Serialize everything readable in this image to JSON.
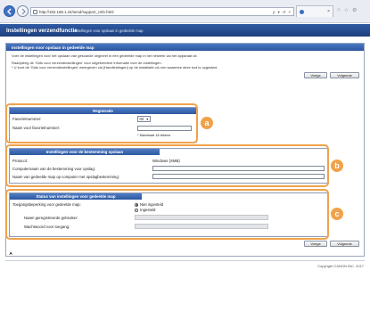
{
  "browser": {
    "url": "http://192.168.1.24/send/support_cnfe.html",
    "addr_tools": [
      "ρ",
      "▾",
      "↺",
      "×"
    ],
    "tab_close": "×",
    "win_tools": [
      "⌂",
      "☆",
      "⚙"
    ]
  },
  "app": {
    "title": "Instellingen verzendfunctie",
    "subtitle": "Instellingen voor opslaan in gedeelde map"
  },
  "section": {
    "title": "Instellingen voor opslaan in gedeelde map",
    "desc_1": "Voer de instellingen voor het opslaan van gescande origineel in een gedeelde map in het netwerk via het apparaat uit.",
    "desc_2": "Raadpleeg de 'Gids voor verzendinstellingen' voor uitgebreidere informatie over de instellingen.",
    "desc_3": "* U kunt de 'Gids voor verzendinstellingen' weergeven via [Handleidingen] op de installatie-cd-rom waarmee deze tool is opgestart."
  },
  "buttons": {
    "prev": "Vorige",
    "next": "Volgende"
  },
  "registration": {
    "title": "Registratie",
    "favorite_label": "Favorietnummer:",
    "favorite_value": "02",
    "favorite_name_label": "Naam voor favorietnummer:",
    "max_note": "* Maximaal 16 tekens"
  },
  "destination": {
    "title": "Instellingen voor de bestemming opslaan",
    "protocol_label": "Protocol:",
    "protocol_value": "Windows (SMB)",
    "computer_label": "Computernaam van de bestemming voor opslag:",
    "folder_label": "Naam van gedeelde map op computer met opslagbestemming:"
  },
  "status": {
    "title": "Status van instellingen voor gedeelde map",
    "access_label": "Toegangsbeperking voor gedeelde map:",
    "option_off": "Niet ingesteld",
    "option_on": "Ingesteld",
    "user_label": "Naam geregistreerde gebruiker:",
    "password_label": "Wachtwoord voor toegang:"
  },
  "callouts": {
    "a": "a",
    "b": "b",
    "c": "c"
  },
  "footer": {
    "top_icon": "⮝",
    "copyright": "Copyright CANON INC. 2017"
  },
  "colors": {
    "accent": "#2f5aa3",
    "callout": "#f0a24a"
  }
}
